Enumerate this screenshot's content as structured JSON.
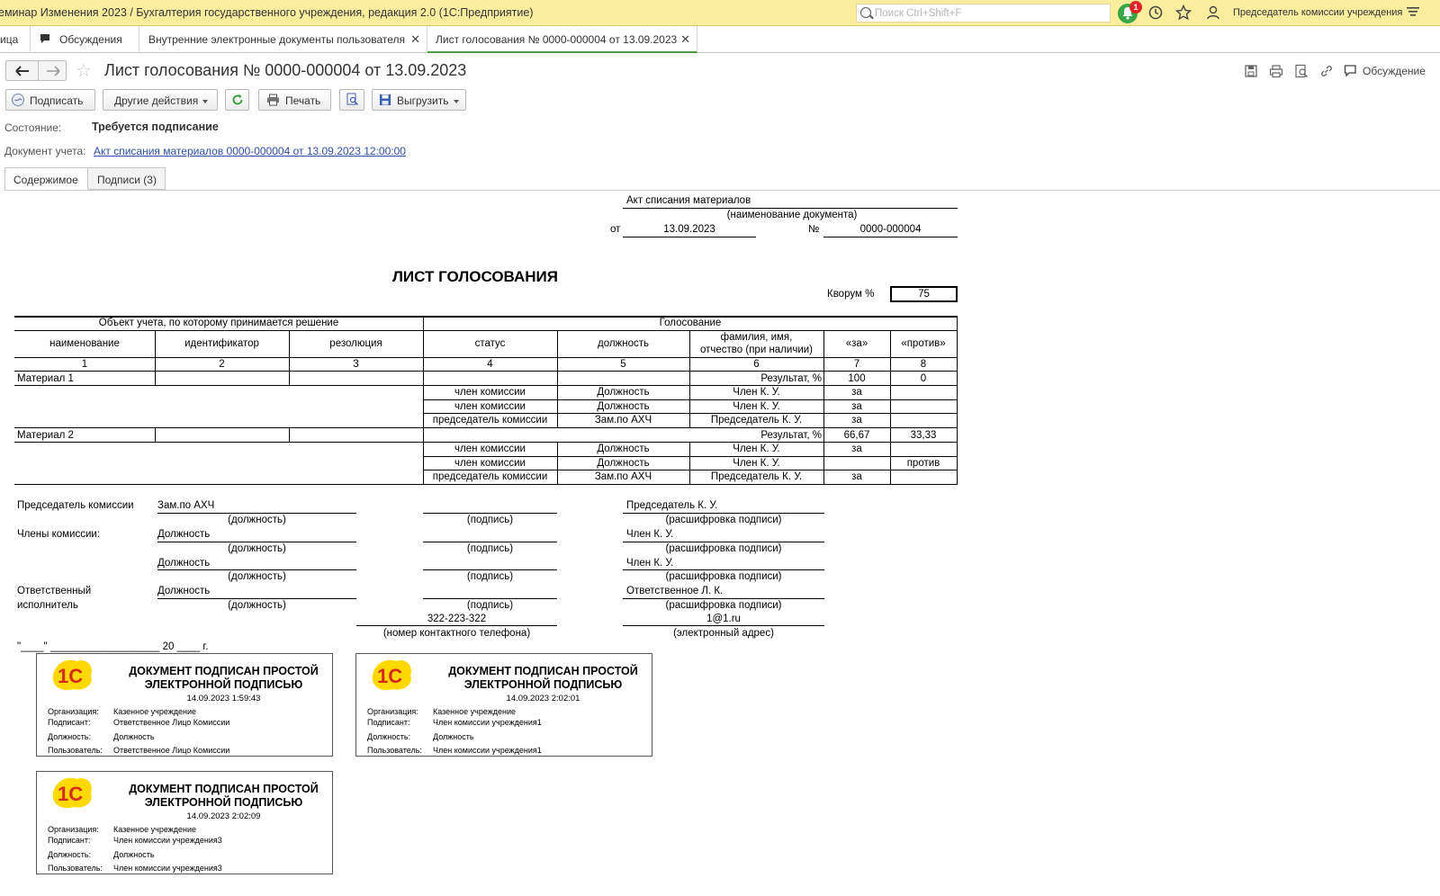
{
  "titlebar": {
    "app_title": "еминар Изменения 2023 / Бухгалтерия государственного учреждения, редакция 2.0  (1С:Предприятие)",
    "search_placeholder": "Поиск Ctrl+Shift+F",
    "notification_count": "1",
    "user": "Председатель комиссии учреждения"
  },
  "tabs": [
    {
      "label": "ица"
    },
    {
      "label": "Обсуждения"
    },
    {
      "label": "Внутренние электронные документы пользователя"
    },
    {
      "label": "Лист голосования № 0000-000004 от 13.09.2023"
    }
  ],
  "header": {
    "title": "Лист голосования № 0000-000004 от 13.09.2023",
    "discussion_label": "Обсуждение"
  },
  "toolbar": {
    "sign": "Подписать",
    "other_actions": "Другие действия",
    "print": "Печать",
    "export": "Выгрузить"
  },
  "fields": {
    "state_label": "Состояние:",
    "state_value": "Требуется подписание",
    "doc_label": "Документ учета:",
    "doc_link": "Акт списания материалов 0000-000004 от 13.09.2023 12:00:00"
  },
  "form_tabs": {
    "content": "Содержимое",
    "signatures": "Подписи (3)"
  },
  "document": {
    "doc_name": "Акт списания материалов",
    "doc_name_caption": "(наименование документа)",
    "from_label": "от",
    "date": "13.09.2023",
    "number_label": "№",
    "number": "0000-000004",
    "title": "ЛИСТ ГОЛОСОВАНИЯ",
    "quorum_label": "Кворум %",
    "quorum_value": "75",
    "table": {
      "group_object": "Объект учета, по которому принимается решение",
      "group_voting": "Голосование",
      "columns": [
        "наименование",
        "идентификатор",
        "резолюция",
        "статус",
        "должность",
        "фамилия, имя,",
        "отчество (при наличии)",
        "«за»",
        "«против»"
      ],
      "column_numbers": [
        "1",
        "2",
        "3",
        "4",
        "5",
        "6",
        "7",
        "8"
      ],
      "result_label": "Результат, %",
      "materials": [
        {
          "name": "Материал 1",
          "for_pct": "100",
          "against_pct": "0",
          "votes": [
            {
              "status": "член комиссии",
              "position": "Должность",
              "fio": "Член К. У.",
              "for": "за",
              "against": ""
            },
            {
              "status": "член комиссии",
              "position": "Должность",
              "fio": "Член К. У.",
              "for": "за",
              "against": ""
            },
            {
              "status": "председатель комиссии",
              "position": "Зам.по АХЧ",
              "fio": "Председатель К. У.",
              "for": "за",
              "against": ""
            }
          ]
        },
        {
          "name": "Материал 2",
          "for_pct": "66,67",
          "against_pct": "33,33",
          "votes": [
            {
              "status": "член комиссии",
              "position": "Должность",
              "fio": "Член К. У.",
              "for": "за",
              "against": ""
            },
            {
              "status": "член комиссии",
              "position": "Должность",
              "fio": "Член К. У.",
              "for": "",
              "against": "против"
            },
            {
              "status": "председатель комиссии",
              "position": "Зам.по АХЧ",
              "fio": "Председатель К. У.",
              "for": "за",
              "against": ""
            }
          ]
        }
      ]
    },
    "signatures": {
      "chairman_label": "Председатель комиссии",
      "members_label": "Члены комиссии:",
      "responsible_label_1": "Ответственный",
      "responsible_label_2": "исполнитель",
      "cap_position": "(должность)",
      "cap_signature": "(подпись)",
      "cap_decoding": "(расшифровка подписи)",
      "cap_phone": "(номер контактного телефона)",
      "cap_email": "(электронный адрес)",
      "rows": [
        {
          "position": "Зам.по АХЧ",
          "name": "Председатель К. У."
        },
        {
          "position": "Должность",
          "name": "Член К. У."
        },
        {
          "position": "Должность",
          "name": "Член К. У."
        },
        {
          "position": "Должность",
          "name": "Ответственное Л. К."
        }
      ],
      "phone": "322-223-322",
      "email": "1@1.ru",
      "date_line": "\"____\" ___________________ 20 ____ г."
    },
    "stamps": [
      {
        "line1": "ДОКУМЕНТ ПОДПИСАН ПРОСТОЙ",
        "line2": "ЭЛЕКТРОННОЙ ПОДПИСЬЮ",
        "datetime": "14.09.2023 1:59:43",
        "org_label": "Организация:",
        "org": "Казенное учреждение",
        "signer_label": "Подписант:",
        "signer": "Ответственное Лицо Комиссии",
        "pos_label": "Должность:",
        "position": "Должность",
        "user_label": "Пользователь:",
        "user": "Ответственное Лицо Комиссии"
      },
      {
        "line1": "ДОКУМЕНТ ПОДПИСАН ПРОСТОЙ",
        "line2": "ЭЛЕКТРОННОЙ ПОДПИСЬЮ",
        "datetime": "14.09.2023 2:02:01",
        "org_label": "Организация:",
        "org": "Казенное учреждение",
        "signer_label": "Подписант:",
        "signer": "Член комиссии учреждения1",
        "pos_label": "Должность:",
        "position": "Должность",
        "user_label": "Пользователь:",
        "user": "Член комиссии учреждения1"
      },
      {
        "line1": "ДОКУМЕНТ ПОДПИСАН ПРОСТОЙ",
        "line2": "ЭЛЕКТРОННОЙ ПОДПИСЬЮ",
        "datetime": "14.09.2023 2:02:09",
        "org_label": "Организация:",
        "org": "Казенное учреждение",
        "signer_label": "Подписант:",
        "signer": "Член комиссии учреждения3",
        "pos_label": "Должность:",
        "position": "Должность",
        "user_label": "Пользователь:",
        "user": "Член комиссии учреждения3"
      }
    ]
  },
  "colors": {
    "titlebar_bg": "#fbed9e",
    "active_tab_accent": "#4c9a3f",
    "link": "#2c4ea8",
    "notification_green": "#3aa545",
    "badge_red": "#e02424",
    "logo_yellow": "#ffd800",
    "logo_red": "#d52b1e"
  },
  "icons": [
    "search-icon",
    "notification-bell-icon",
    "history-icon",
    "favorites-star-icon",
    "user-icon",
    "menu-icon",
    "discussion-icon",
    "close-icon",
    "back-arrow-icon",
    "forward-arrow-icon",
    "save-icon",
    "print-icon",
    "preview-icon",
    "link-icon",
    "refresh-icon",
    "sign-icon",
    "1c-logo"
  ]
}
